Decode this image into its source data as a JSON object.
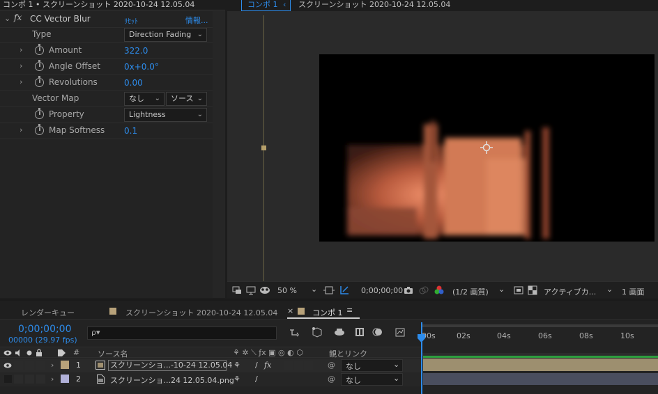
{
  "effect_panel": {
    "header": "コンポ 1 • スクリーンショット 2020-10-24 12.05.04",
    "fx_label": "fx",
    "effect_name": "CC Vector Blur",
    "reset": "ﾘｾｯﾄ",
    "info": "情報...",
    "properties": {
      "type": {
        "label": "Type",
        "value": "Direction Fading"
      },
      "amount": {
        "label": "Amount",
        "value": "322.0"
      },
      "angle_offset": {
        "label": "Angle Offset",
        "value": "0x+0.0°"
      },
      "revolutions": {
        "label": "Revolutions",
        "value": "0.00"
      },
      "vector_map": {
        "label": "Vector Map",
        "layer_value": "なし",
        "source_value": "ソース"
      },
      "property": {
        "label": "Property",
        "value": "Lightness"
      },
      "map_softness": {
        "label": "Map Softness",
        "value": "0.1"
      }
    }
  },
  "viewer": {
    "active_tab": "コンポ 1",
    "breadcrumb": "スクリーンショット 2020-10-24 12.05.04",
    "toolbar": {
      "zoom": "50 %",
      "timecode": "0;00;00;00",
      "resolution": "(1/2 画質)",
      "camera": "アクティブカ...",
      "views": "1 画面"
    }
  },
  "timeline": {
    "tabs": [
      {
        "label": "レンダーキュー"
      },
      {
        "label": "スクリーンショット 2020-10-24 12.05.04",
        "color": "#b8a27a"
      },
      {
        "label": "コンポ 1",
        "color": "#b8a27a",
        "close": "×",
        "menu": "≡"
      }
    ],
    "timecode": "0;00;00;00",
    "fps": "00000 (29.97 fps)",
    "search_glyph": "ρ▾",
    "columns": {
      "number": "#",
      "source_name": "ソース名",
      "parent": "親とリンク"
    },
    "ruler_ticks": [
      "00s",
      "02s",
      "04s",
      "06s",
      "08s",
      "10s"
    ],
    "layers": [
      {
        "number": "1",
        "name": "スクリーンショ...-10-24 12.05.04",
        "parent": "なし",
        "fx": "fx",
        "label_color": "#b8a27a"
      },
      {
        "number": "2",
        "name": "スクリーンショ...24 12.05.04.png",
        "parent": "なし",
        "label_color": "#b0b0d8"
      }
    ]
  },
  "colors": {
    "accent": "#2d8ceb",
    "layer1_bar": "#9d8f6f",
    "layer2_bar": "#4a4e5e",
    "work_area": "#2e9e3e"
  }
}
